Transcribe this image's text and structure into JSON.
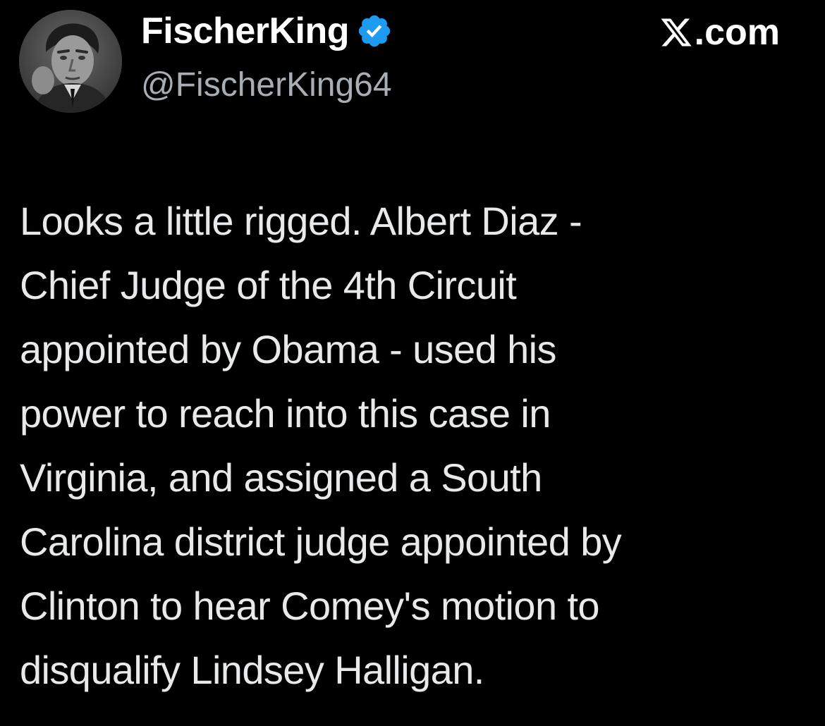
{
  "author": {
    "display_name": "FischerKing",
    "handle": "@FischerKing64",
    "verified": true,
    "verified_color": "#1d9bf0",
    "avatar_icon": "grayscale-portrait-avatar"
  },
  "source": {
    "logo_icon": "x-logo-icon",
    "domain_suffix": ".com"
  },
  "tweet": {
    "lines": [
      "Looks a little rigged. Albert Diaz -",
      "Chief Judge of the 4th Circuit",
      "appointed by Obama - used his",
      "power to reach into this case in",
      "Virginia, and assigned a South",
      "Carolina district judge appointed by",
      "Clinton to hear Comey's motion to",
      "disqualify Lindsey Halligan."
    ]
  },
  "colors": {
    "background": "#000000",
    "text": "#e7e9ea",
    "secondary_text": "#a8aeb3",
    "accent": "#1d9bf0"
  }
}
